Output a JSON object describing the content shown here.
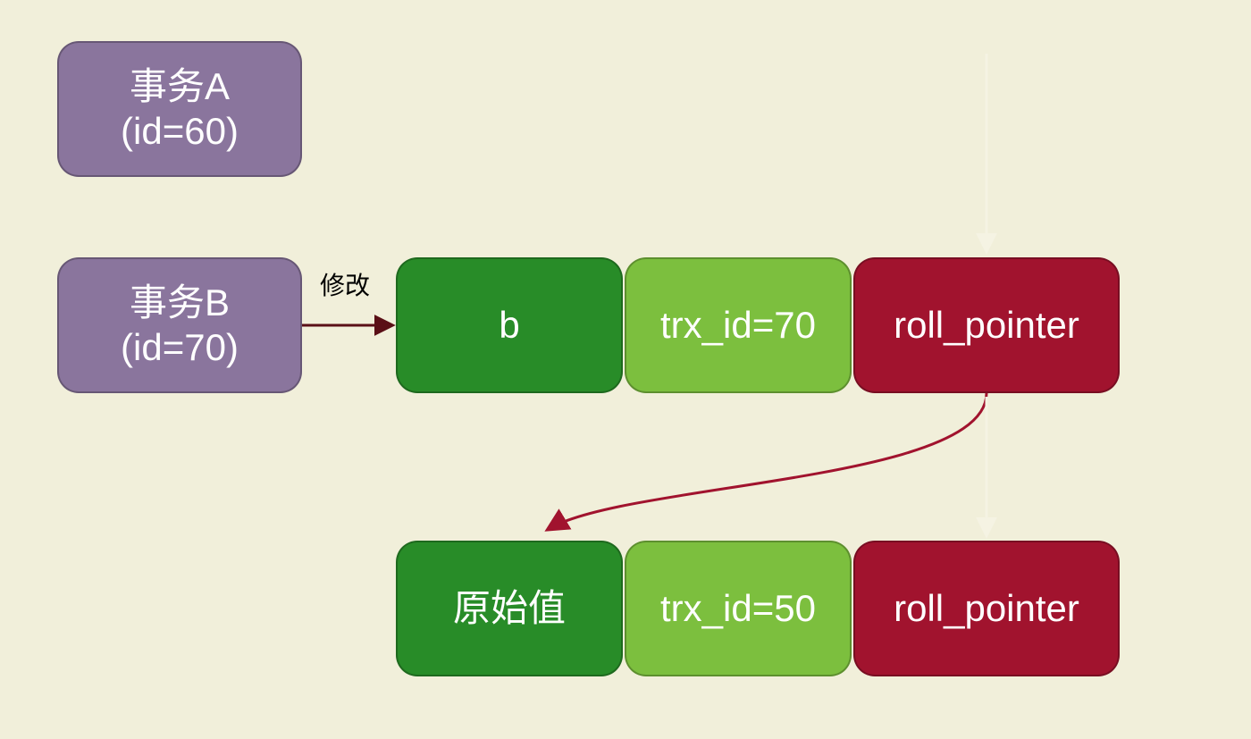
{
  "transactionA": {
    "title": "事务A",
    "id_label": "(id=60)"
  },
  "transactionB": {
    "title": "事务B",
    "id_label": "(id=70)"
  },
  "edge_label": "修改",
  "row1": {
    "value": "b",
    "trx": "trx_id=70",
    "roll": "roll_pointer"
  },
  "row2": {
    "value": "原始值",
    "trx": "trx_id=50",
    "roll": "roll_pointer"
  },
  "colors": {
    "purple": "#8a759d",
    "dark_green": "#288c28",
    "light_green": "#7cbf3e",
    "dark_red": "#a1132e",
    "background": "#f1efda"
  }
}
